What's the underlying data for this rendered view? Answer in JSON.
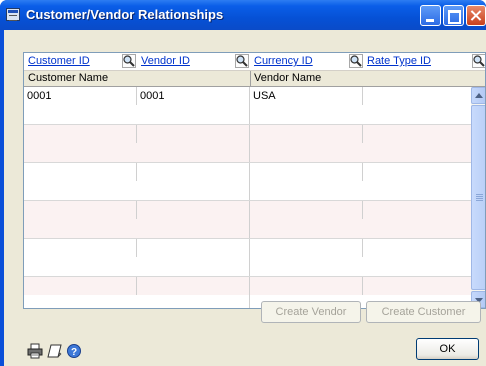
{
  "window": {
    "title": "Customer/Vendor Relationships"
  },
  "grid": {
    "header_row1": [
      {
        "label": "Customer ID"
      },
      {
        "label": "Vendor ID"
      },
      {
        "label": "Currency ID"
      },
      {
        "label": "Rate Type ID"
      }
    ],
    "header_row2": [
      "Customer Name",
      "Vendor Name"
    ],
    "rows": [
      [
        "0001",
        "0001",
        "USA",
        ""
      ]
    ]
  },
  "buttons": {
    "create_vendor": "Create Vendor",
    "create_customer": "Create Customer",
    "ok": "OK"
  },
  "icons": [
    "printer-icon",
    "note-icon",
    "help-icon",
    "lookup-icon"
  ],
  "colors": {
    "titlebar": "#0651d6",
    "link": "#0033cc",
    "row_tint": "#fbf2f2"
  }
}
